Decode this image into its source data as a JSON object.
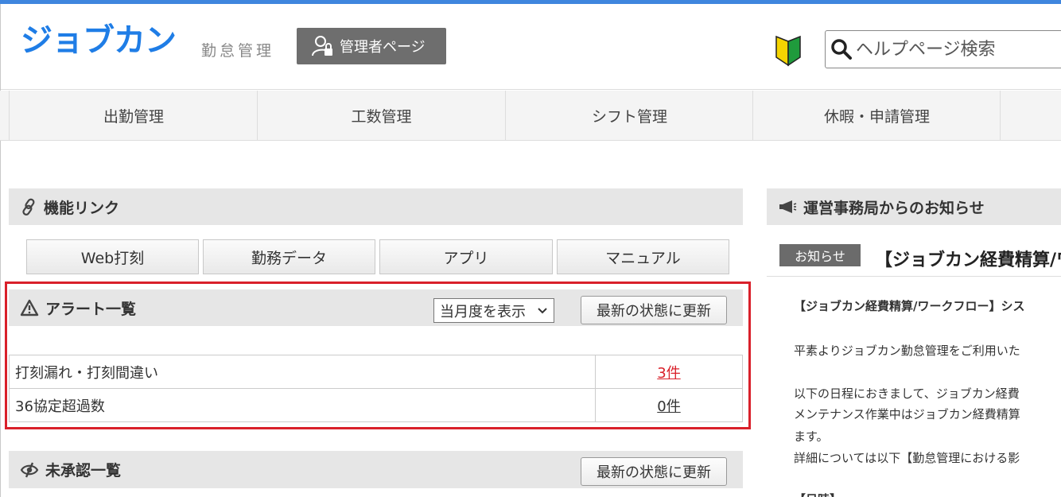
{
  "header": {
    "logo": "ジョブカン",
    "logo_sub": "勤怠管理",
    "admin_button": "管理者ページ",
    "search_placeholder": "ヘルプページ検索"
  },
  "nav": {
    "items": [
      "出勤管理",
      "工数管理",
      "シフト管理",
      "休暇・申請管理"
    ]
  },
  "function_links": {
    "title": "機能リンク",
    "buttons": [
      "Web打刻",
      "勤務データ",
      "アプリ",
      "マニュアル"
    ]
  },
  "alerts": {
    "title": "アラート一覧",
    "period_select": "当月度を表示",
    "refresh_label": "最新の状態に更新",
    "rows": [
      {
        "label": "打刻漏れ・打刻間違い",
        "count": "3件"
      },
      {
        "label": "36協定超過数",
        "count": "0件"
      }
    ],
    "accent_color": "#d9202a"
  },
  "unapproved": {
    "title": "未承認一覧",
    "refresh_label": "最新の状態に更新"
  },
  "news": {
    "title": "運営事務局からのお知らせ",
    "tag": "お知らせ",
    "headline": "【ジョブカン経費精算/ワ",
    "lines": [
      "【ジョブカン経費精算/ワークフロー】シス",
      "平素よりジョブカン勤怠管理をご利用いた",
      "以下の日程におきまして、ジョブカン経費",
      "メンテナンス作業中はジョブカン経費精算",
      "ます。",
      "詳細については以下【勤怠管理における影",
      "【日時】"
    ]
  },
  "colors": {
    "brand": "#1f7de6",
    "top_accent": "#3f86de"
  }
}
